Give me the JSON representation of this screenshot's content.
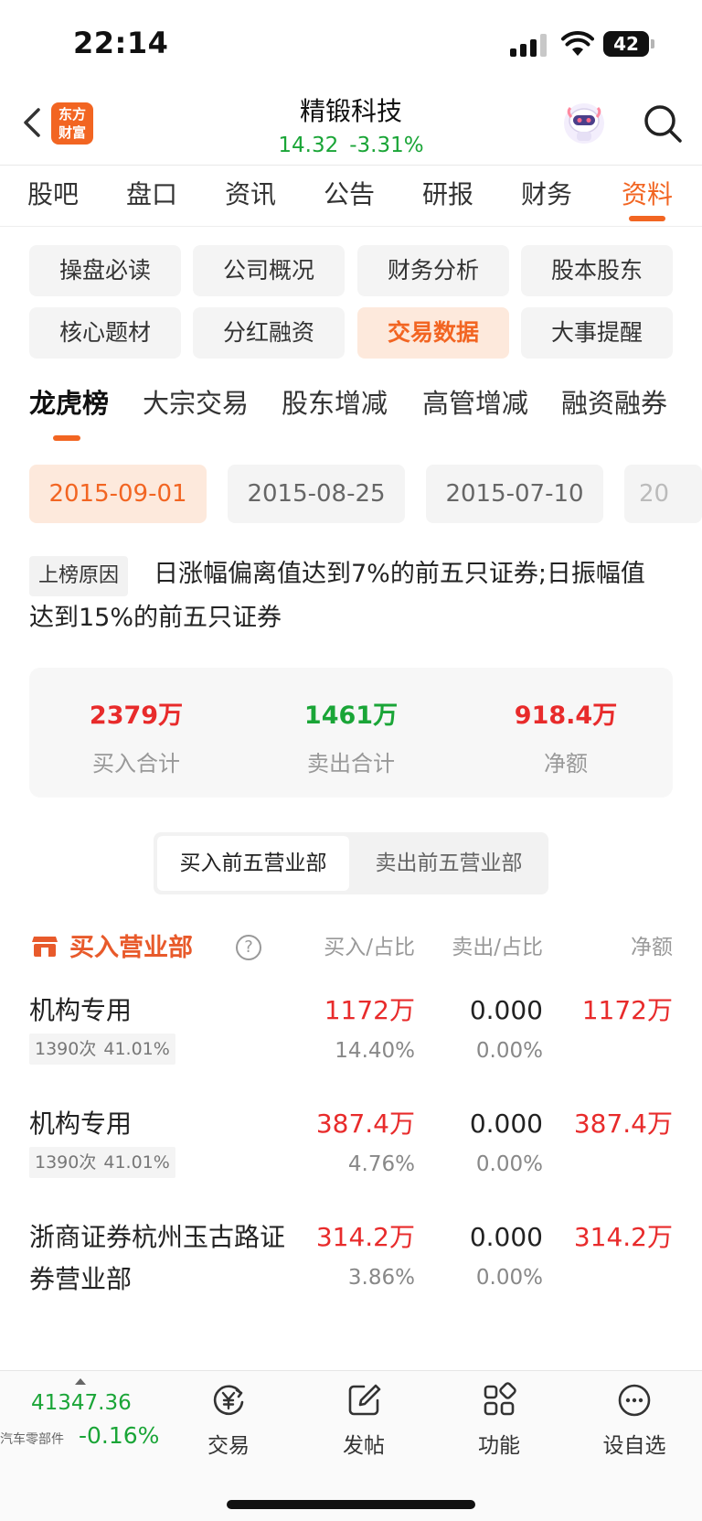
{
  "status": {
    "time": "22:14",
    "battery": "42"
  },
  "header": {
    "logo_line1": "东方",
    "logo_line2": "财富",
    "stock_name": "精锻科技",
    "price": "14.32",
    "change": "-3.31%"
  },
  "main_tabs": [
    "股吧",
    "盘口",
    "资讯",
    "公告",
    "研报",
    "财务",
    "资料"
  ],
  "active_main_tab": "资料",
  "grid_buttons": [
    "操盘必读",
    "公司概况",
    "财务分析",
    "股本股东",
    "核心题材",
    "分红融资",
    "交易数据",
    "大事提醒"
  ],
  "active_grid_button": "交易数据",
  "sub_tabs": [
    "龙虎榜",
    "大宗交易",
    "股东增减",
    "高管增减",
    "融资融券"
  ],
  "active_sub_tab": "龙虎榜",
  "dates": [
    "2015-09-01",
    "2015-08-25",
    "2015-07-10",
    "20"
  ],
  "reason": {
    "tag": "上榜原因",
    "text": "日涨幅偏离值达到7%的前五只证券;日振幅值达到15%的前五只证券"
  },
  "summary": {
    "buy_total": "2379万",
    "buy_label": "买入合计",
    "sell_total": "1461万",
    "sell_label": "卖出合计",
    "net": "918.4万",
    "net_label": "净额"
  },
  "segmented": {
    "buy_top5": "买入前五营业部",
    "sell_top5": "卖出前五营业部"
  },
  "list": {
    "title": "买入营业部",
    "help": "?",
    "col_buy": "买入/占比",
    "col_sell": "卖出/占比",
    "col_net": "净额",
    "rows": [
      {
        "name": "机构专用",
        "count": "1390次",
        "rate": "41.01%",
        "buy": "1172万",
        "buy_pct": "14.40%",
        "sell": "0.000",
        "sell_pct": "0.00%",
        "net": "1172万"
      },
      {
        "name": "机构专用",
        "count": "1390次",
        "rate": "41.01%",
        "buy": "387.4万",
        "buy_pct": "4.76%",
        "sell": "0.000",
        "sell_pct": "0.00%",
        "net": "387.4万"
      },
      {
        "name": "浙商证券杭州玉古路证券营业部",
        "buy": "314.2万",
        "buy_pct": "3.86%",
        "sell": "0.000",
        "sell_pct": "0.00%",
        "net": "314.2万"
      }
    ]
  },
  "bottom_bar": {
    "index_value": "41347.36",
    "index_name": "汽车零部件",
    "index_change": "-0.16%",
    "nav": [
      {
        "label": "交易",
        "icon": "yuan-trade-icon"
      },
      {
        "label": "发帖",
        "icon": "edit-post-icon"
      },
      {
        "label": "功能",
        "icon": "grid-apps-icon"
      },
      {
        "label": "设自选",
        "icon": "more-dots-icon"
      }
    ]
  },
  "colors": {
    "accent": "#f26522",
    "up": "#e82b2b",
    "down": "#1aa537"
  }
}
